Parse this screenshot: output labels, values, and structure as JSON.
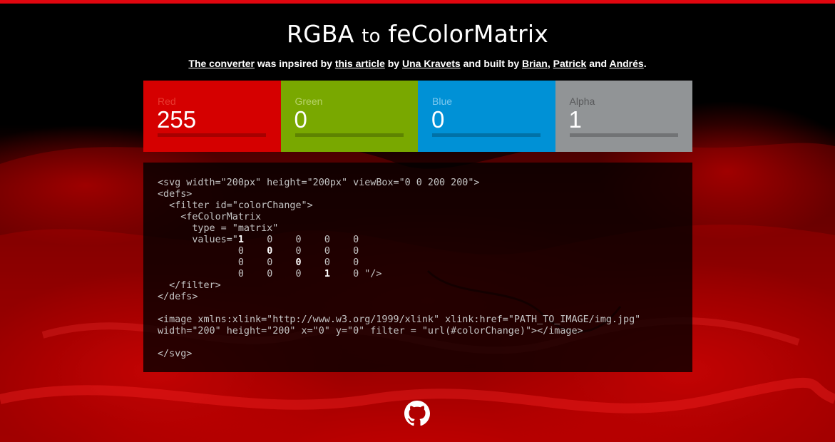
{
  "title": {
    "part1": "RGBA",
    "part2": "to",
    "part3": "feColorMatrix"
  },
  "credits": {
    "converter_link": "The converter",
    "text1": " was inpsired by ",
    "article_link": "this article",
    "text2": " by ",
    "author_link": "Una Kravets",
    "text3": " and built by ",
    "brian_link": "Brian",
    "comma": ",",
    "patrick_link": "Patrick",
    "text4": " and ",
    "andres_link": "Andrés",
    "period": "."
  },
  "panels": [
    {
      "label": "Red",
      "value": "255",
      "fraction": 1.0,
      "bg": "#d50000",
      "label_color": "#e8392f"
    },
    {
      "label": "Green",
      "value": "0",
      "fraction": 0.0,
      "bg": "#79a800",
      "label_color": "#b8d36a"
    },
    {
      "label": "Blue",
      "value": "0",
      "fraction": 0.0,
      "bg": "#0091d6",
      "label_color": "#7cc8ee"
    },
    {
      "label": "Alpha",
      "value": "1",
      "fraction": 1.0,
      "bg": "#919496",
      "label_color": "#58595b"
    }
  ],
  "code": {
    "l1": "<svg width=\"200px\" height=\"200px\" viewBox=\"0 0 200 200\">",
    "l2": "<defs>",
    "l3": "  <filter id=\"colorChange\">",
    "l4": "    <feColorMatrix",
    "l5": "      type = \"matrix\"",
    "l6_pre": "      values=\"",
    "m": [
      [
        "1",
        "0",
        "0",
        "0",
        "0"
      ],
      [
        "0",
        "0",
        "0",
        "0",
        "0"
      ],
      [
        "0",
        "0",
        "0",
        "0",
        "0"
      ],
      [
        "0",
        "0",
        "0",
        "1",
        "0"
      ]
    ],
    "matrix_end": " \"/>",
    "l10": "  </filter>",
    "l11": "</defs>",
    "l13": "<image xmlns:xlink=\"http://www.w3.org/1999/xlink\" xlink:href=\"PATH_TO_IMAGE/img.jpg\"",
    "l14": "width=\"200\" height=\"200\" x=\"0\" y=\"0\" filter = \"url(#colorChange)\"></image>",
    "l16": "</svg>"
  },
  "icons": {
    "github": "github-icon"
  },
  "colors": {
    "accent": "#e0060f"
  }
}
